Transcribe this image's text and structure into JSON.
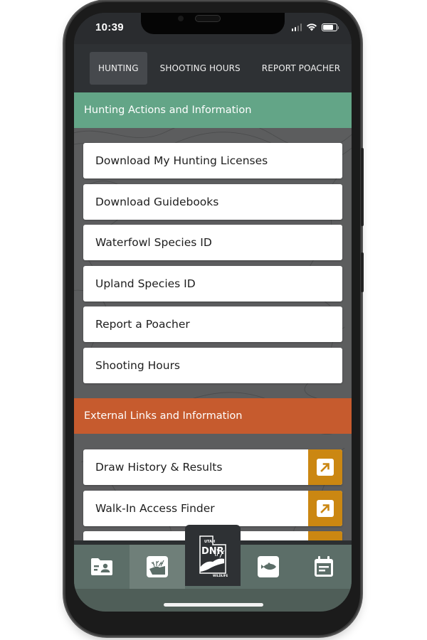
{
  "status_bar": {
    "time": "10:39",
    "icons": [
      "cellular-signal-icon",
      "wifi-icon",
      "battery-icon"
    ]
  },
  "tabs": [
    {
      "label": "HUNTING",
      "active": true
    },
    {
      "label": "SHOOTING HOURS",
      "active": false
    },
    {
      "label": "REPORT POACHER",
      "active": false
    }
  ],
  "sections": {
    "hunting": {
      "title": "Hunting Actions and Information",
      "color": "#63a587",
      "items": [
        {
          "label": "Download My Hunting Licenses"
        },
        {
          "label": "Download Guidebooks"
        },
        {
          "label": "Waterfowl Species ID"
        },
        {
          "label": "Upland Species ID"
        },
        {
          "label": "Report a Poacher"
        },
        {
          "label": "Shooting Hours"
        }
      ]
    },
    "external": {
      "title": "External Links and Information",
      "color": "#c65b2e",
      "link_icon": "external-link-arrow-icon",
      "link_color": "#cb8712",
      "items": [
        {
          "label": "Draw History & Results"
        },
        {
          "label": "Walk-In Access Finder"
        },
        {
          "label": ""
        }
      ]
    }
  },
  "bottom_nav": {
    "items": [
      {
        "icon": "license-folder-icon",
        "active": false
      },
      {
        "icon": "hunting-elk-icon",
        "active": true
      },
      {
        "icon": "utah-dnr-logo",
        "active": false
      },
      {
        "icon": "fishing-fish-icon",
        "active": false
      },
      {
        "icon": "calendar-icon",
        "active": false
      }
    ],
    "logo": {
      "top_text": "UTAH",
      "main_text": "DNR",
      "bottom_text": "WILDLIFE"
    }
  }
}
